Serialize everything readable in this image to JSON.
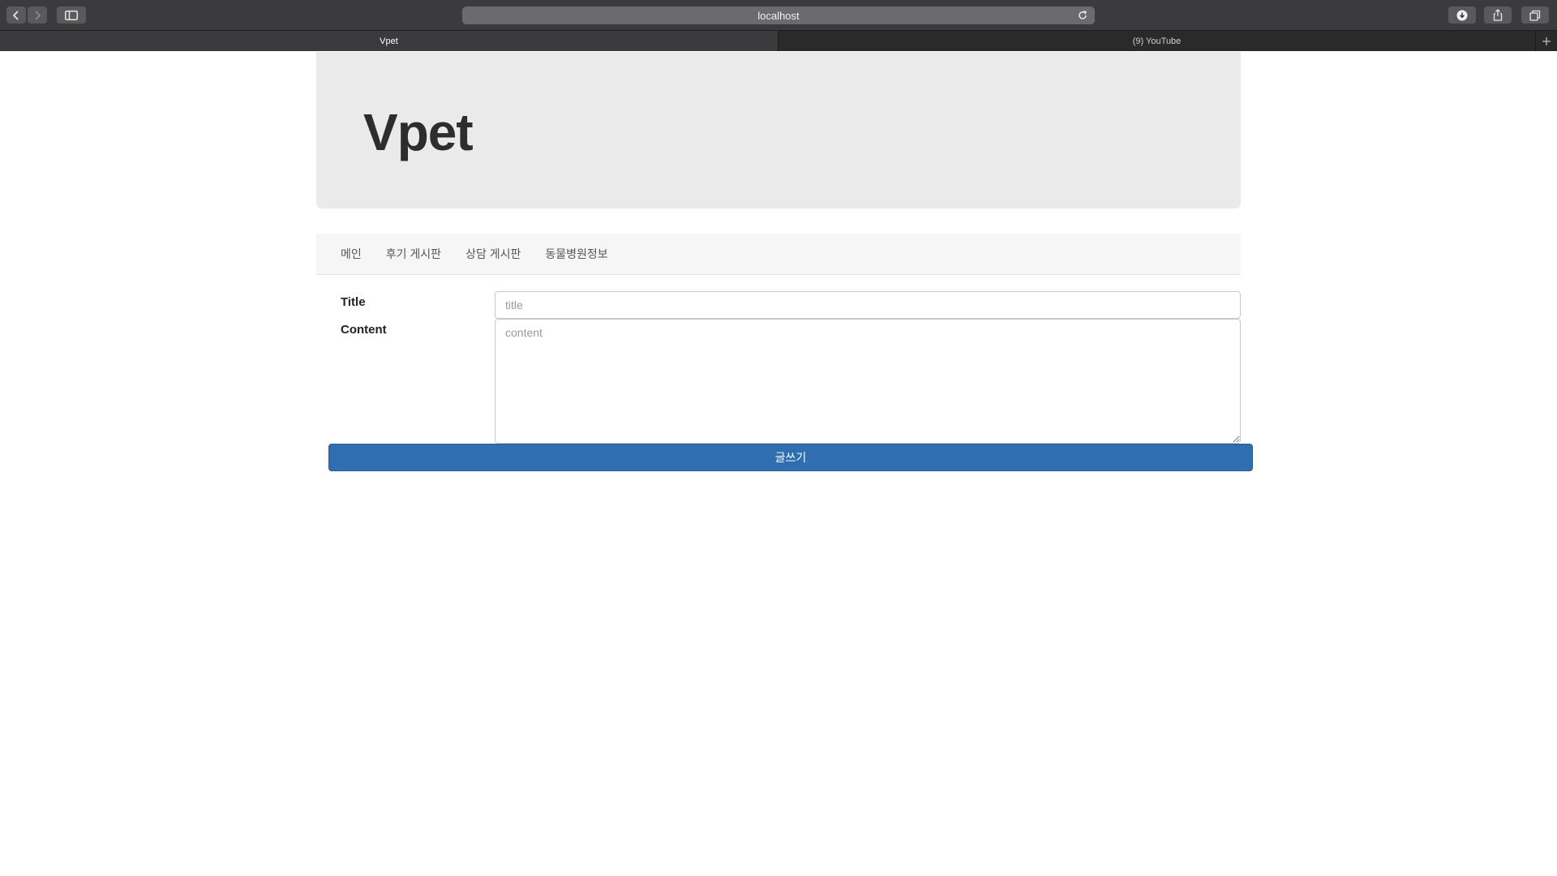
{
  "browser": {
    "url": "localhost",
    "tabs": [
      {
        "label": "Vpet",
        "active": true
      },
      {
        "label": "(9) YouTube",
        "active": false
      }
    ],
    "icons": [
      "back-icon",
      "forward-icon",
      "sidebar-icon",
      "reload-icon",
      "download-icon",
      "share-icon",
      "tabs-overview-icon",
      "new-tab-icon"
    ]
  },
  "header": {
    "title": "Vpet"
  },
  "nav": {
    "items": [
      {
        "label": "메인"
      },
      {
        "label": "후기 게시판"
      },
      {
        "label": "상담 게시판"
      },
      {
        "label": "동물병원정보"
      }
    ]
  },
  "form": {
    "title_label": "Title",
    "title_placeholder": "title",
    "title_value": "",
    "content_label": "Content",
    "content_placeholder": "content",
    "content_value": "",
    "submit_label": "글쓰기"
  },
  "colors": {
    "primary_button": "#2f6fb1",
    "jumbotron_bg": "#eaeaea",
    "navbar_bg": "#f6f6f6",
    "chrome_bg": "#3b3b3d"
  }
}
